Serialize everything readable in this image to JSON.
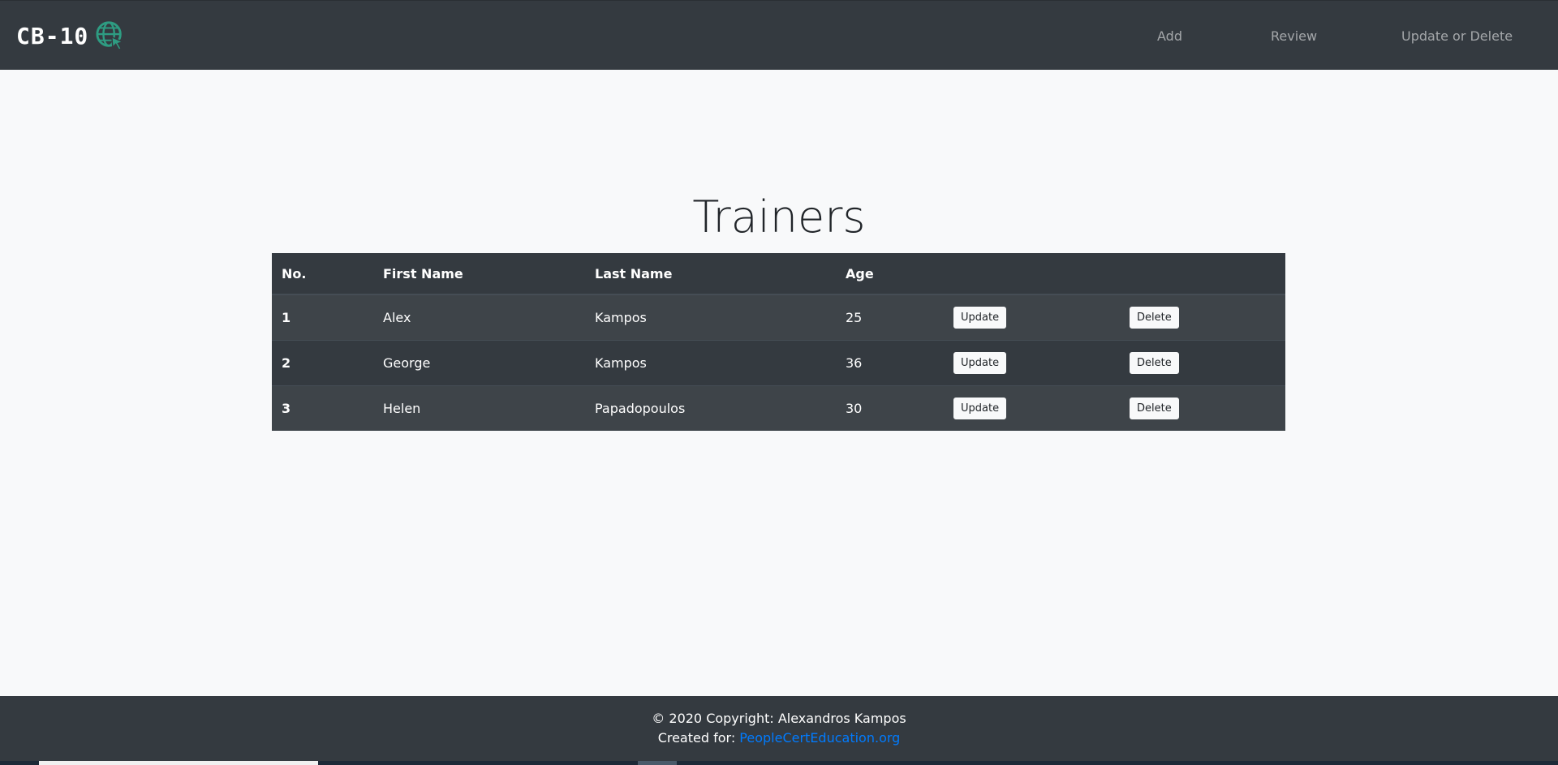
{
  "navbar": {
    "brand": "CB-10",
    "brand_icon": "globe-cursor-icon",
    "links": [
      "Add",
      "Review",
      "Update or Delete"
    ]
  },
  "page": {
    "title": "Trainers"
  },
  "table": {
    "headers": [
      "No.",
      "First Name",
      "Last Name",
      "Age"
    ],
    "rows": [
      {
        "no": "1",
        "first": "Alex",
        "last": "Kampos",
        "age": "25"
      },
      {
        "no": "2",
        "first": "George",
        "last": "Kampos",
        "age": "36"
      },
      {
        "no": "3",
        "first": "Helen",
        "last": "Papadopoulos",
        "age": "30"
      }
    ],
    "update_label": "Update",
    "delete_label": "Delete"
  },
  "footer": {
    "copyright": "© 2020 Copyright: Alexandros Kampos",
    "created_for_label": "Created for:",
    "link_text": "PeopleCertEducation.org"
  },
  "colors": {
    "navbar_bg": "#343a40",
    "page_bg": "#f8f9fa",
    "accent_icon": "#2e9c82",
    "link": "#007bff"
  }
}
